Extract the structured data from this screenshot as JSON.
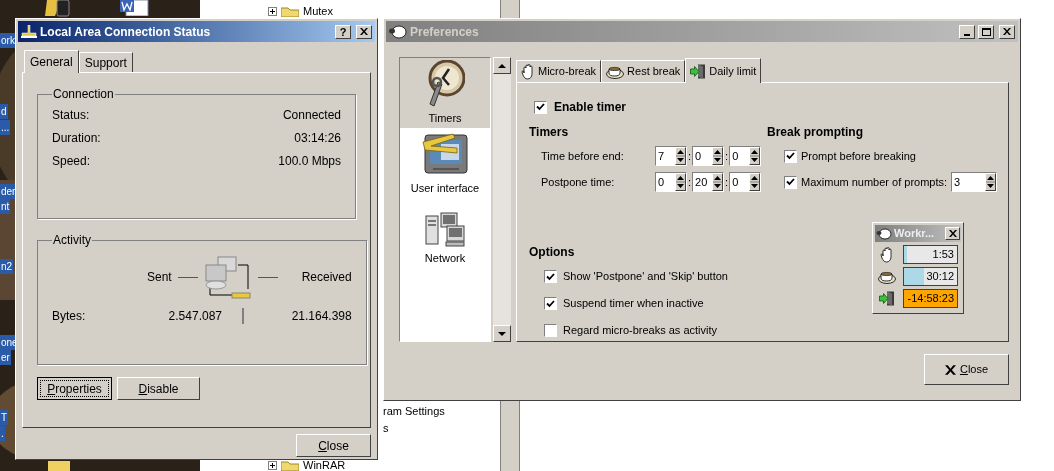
{
  "desktop": {
    "labels": [
      "ork",
      "d",
      "...",
      "der",
      "nt",
      "n2",
      "one",
      "er",
      "T",
      "."
    ]
  },
  "explorer": {
    "tree_items": [
      {
        "label": "Mutex",
        "folder": true
      },
      {
        "label": "ram Settings",
        "folder": false
      },
      {
        "label": "s",
        "folder": false
      },
      {
        "label": "WinRAR",
        "folder": true
      }
    ]
  },
  "connection_window": {
    "title": "Local Area Connection Status",
    "help_button": "?",
    "tabs": [
      {
        "label": "General",
        "selected": true
      },
      {
        "label": "Support",
        "selected": false
      }
    ],
    "connection": {
      "title": "Connection",
      "rows": [
        {
          "label": "Status:",
          "value": "Connected"
        },
        {
          "label": "Duration:",
          "value": "03:14:26"
        },
        {
          "label": "Speed:",
          "value": "100.0 Mbps"
        }
      ]
    },
    "activity": {
      "title": "Activity",
      "sent_label": "Sent",
      "received_label": "Received",
      "bytes_label": "Bytes:",
      "sent": "2.547.087",
      "received": "21.164.398"
    },
    "buttons": [
      {
        "label": "Properties",
        "focused": true
      },
      {
        "label": "Disable",
        "focused": false
      }
    ],
    "close_button": "Close"
  },
  "preferences_window": {
    "title": "Preferences",
    "sidebar": [
      {
        "label": "Timers",
        "kind": "clock",
        "selected": true
      },
      {
        "label": "User interface",
        "kind": "monitor",
        "selected": false
      },
      {
        "label": "Network",
        "kind": "network",
        "selected": false
      }
    ],
    "tabs": [
      {
        "label": "Micro-break",
        "kind": "hand",
        "selected": false
      },
      {
        "label": "Rest break",
        "kind": "cup",
        "selected": false
      },
      {
        "label": "Daily limit",
        "kind": "exit",
        "selected": true
      }
    ],
    "enable_timer": {
      "label": "Enable timer",
      "checked": true
    },
    "timers": {
      "title": "Timers",
      "separator": ":",
      "rows": [
        {
          "label": "Time before end:",
          "values": [
            "7",
            "0",
            "0"
          ]
        },
        {
          "label": "Postpone time:",
          "values": [
            "0",
            "20",
            "0"
          ]
        }
      ]
    },
    "break_prompting": {
      "title": "Break prompting",
      "items": [
        {
          "label": "Prompt before breaking",
          "checked": true
        },
        {
          "label": "Maximum number of prompts:",
          "checked": true,
          "value": "3"
        }
      ]
    },
    "options": {
      "title": "Options",
      "items": [
        {
          "label": "Show 'Postpone' and 'Skip' button",
          "checked": true
        },
        {
          "label": "Suspend timer when inactive",
          "checked": true
        },
        {
          "label": "Regard micro-breaks as activity",
          "checked": false
        }
      ]
    },
    "status_window": {
      "title": "Workr...",
      "rows": [
        {
          "kind": "hand",
          "value": "1:53",
          "level": 0.05,
          "overdue": false
        },
        {
          "kind": "cup",
          "value": "30:12",
          "level": 0.38,
          "overdue": false
        },
        {
          "kind": "exit",
          "value": "-14:58:23",
          "level": 1,
          "overdue": true
        }
      ]
    },
    "close_button": "Close"
  }
}
